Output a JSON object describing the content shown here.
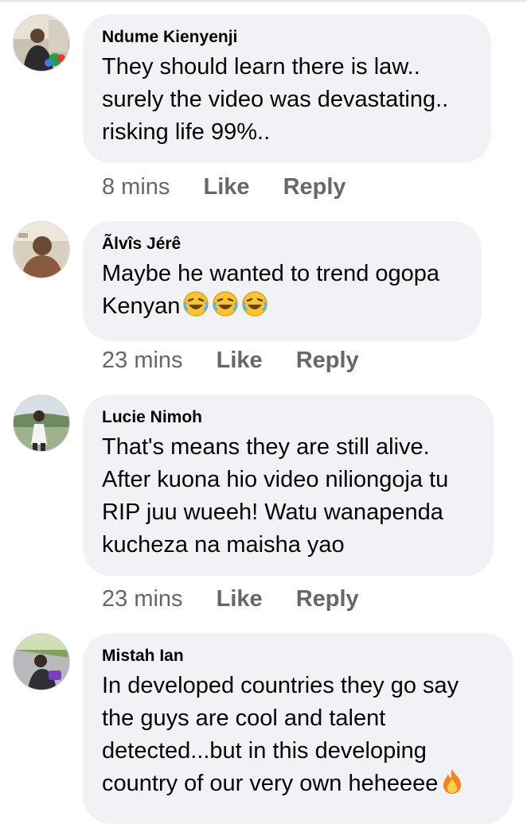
{
  "comments": [
    {
      "author": "Ndume Kienyenji",
      "lines": [
        "They should learn there is law..",
        "surely the video was devastating..",
        "risking life 99%.."
      ],
      "time": "8 mins",
      "like_label": "Like",
      "reply_label": "Reply",
      "avatar_icon": "profile-photo"
    },
    {
      "author": "Ãlvîs Jérê",
      "lines": [
        "Maybe he wanted to trend ogopa",
        "Kenyan"
      ],
      "emoji": [
        "rolling-on-floor-laughing-emoji",
        "rolling-on-floor-laughing-emoji",
        "rolling-on-floor-laughing-emoji"
      ],
      "time": "23 mins",
      "like_label": "Like",
      "reply_label": "Reply",
      "avatar_icon": "profile-photo"
    },
    {
      "author": "Lucie Nimoh",
      "lines": [
        "That's means they are still alive.",
        "After kuona hio video niliongoja tu",
        "RIP juu wueeh! Watu wanapenda",
        "kucheza na maisha yao"
      ],
      "time": "23 mins",
      "like_label": "Like",
      "reply_label": "Reply",
      "avatar_icon": "profile-photo"
    },
    {
      "author": "Mistah Ian",
      "lines": [
        "In developed countries they go say",
        "the guys are cool and talent",
        "detected...but in this developing",
        "country of our very own heheeee"
      ],
      "emoji": [
        "fire-emoji"
      ],
      "avatar_icon": "profile-photo"
    }
  ],
  "colors": {
    "bubble": "#f0f2f5",
    "meta_text": "#65676b",
    "body_text": "#050505"
  }
}
